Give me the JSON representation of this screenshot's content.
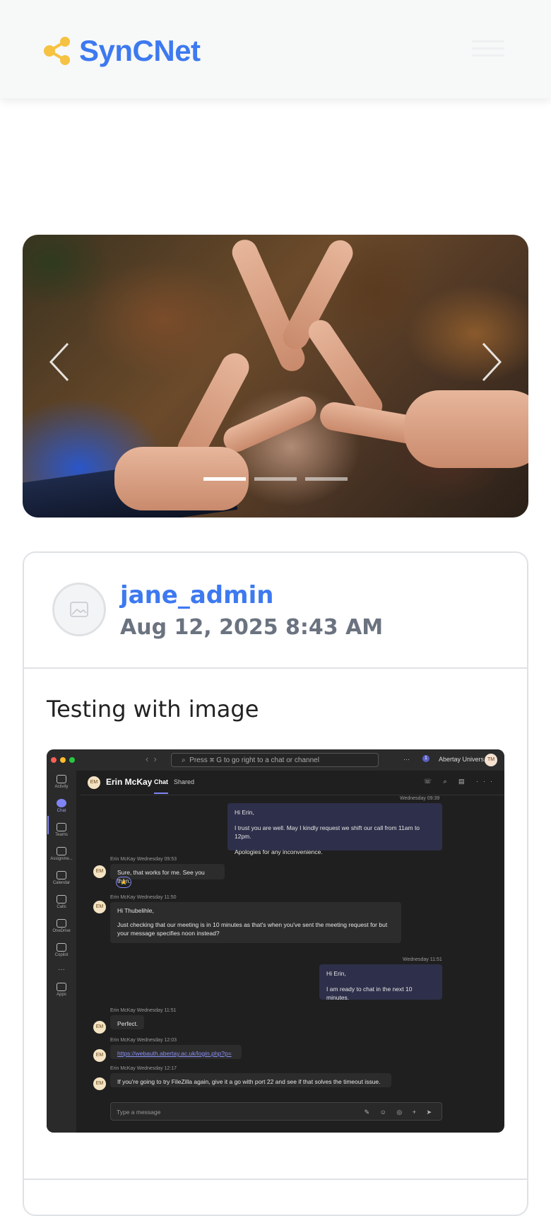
{
  "header": {
    "brand": "SynCNet",
    "logo_icon": "share-nodes-icon",
    "brand_color": "#3d79f0",
    "logo_color": "#f5c242"
  },
  "carousel": {
    "prev_icon": "chevron-left-icon",
    "next_icon": "chevron-right-icon",
    "active_slide": 1,
    "slide_count": 3
  },
  "post": {
    "username": "jane_admin",
    "timestamp": "Aug 12, 2025 8:43 AM",
    "text": "Testing with image",
    "screenshot": {
      "search_placeholder": "Press ⌘ G to go right to a chat or channel",
      "org": "Abertay Univers...",
      "user_initials": "TM",
      "notif_count": "1",
      "rail": [
        "Activity",
        "Chat",
        "Teams",
        "Assignme...",
        "Calendar",
        "Calls",
        "OneDrive",
        "Copilot",
        "Apps"
      ],
      "contact": "Erin McKay",
      "contact_initials": "EM",
      "tabs": [
        "Chat",
        "Shared"
      ],
      "messages": {
        "m1_time": "Wednesday 09:39",
        "m1_l1": "Hi Erin,",
        "m1_l2": "I trust you are well. May I kindly request we shift our call from 11am to 12pm.",
        "m1_l3": "Apologies for any inconvenience.",
        "m2_meta": "Erin McKay  Wednesday 09:53",
        "m2_text": "Sure, that works for me. See you then.",
        "m3_meta": "Erin McKay  Wednesday 11:50",
        "m3_l1": "Hi Thubelihle,",
        "m3_l2": "Just checking that our meeting is in 10 minutes as that's when you've sent the meeting request for but",
        "m3_l3": "your message specifies noon instead?",
        "m4_time": "Wednesday 11:51",
        "m4_l1": "Hi Erin,",
        "m4_l2": "I am ready to chat in the next 10 minutes.",
        "m5_meta": "Erin McKay  Wednesday 11:51",
        "m5_text": "Perfect.",
        "m6_meta": "Erin McKay  Wednesday 12:03",
        "m6_text": "https://webauth.abertay.ac.uk/login.php?p=",
        "m7_meta": "Erin McKay  Wednesday 12:17",
        "m7_text": "If you're going to try FileZilla again, give it a go with port 22 and see if that solves the timeout issue."
      },
      "compose_placeholder": "Type a message"
    }
  }
}
